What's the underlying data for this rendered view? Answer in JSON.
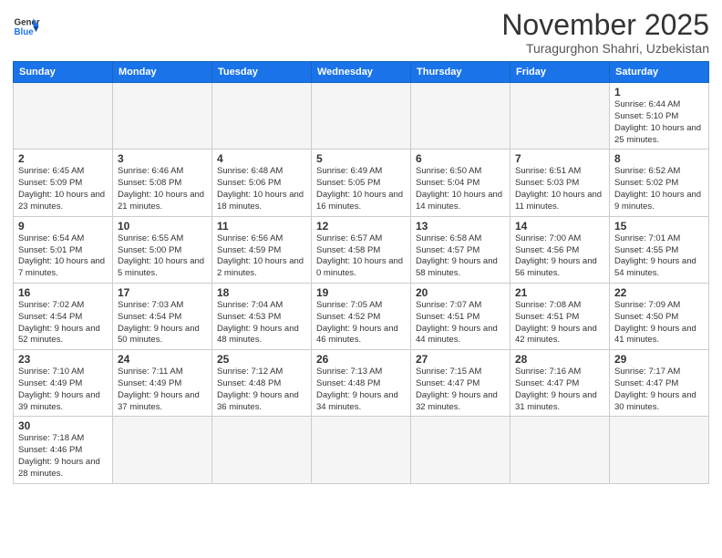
{
  "header": {
    "logo_line1": "General",
    "logo_line2": "Blue",
    "month": "November 2025",
    "location": "Turagurghon Shahri, Uzbekistan"
  },
  "days_of_week": [
    "Sunday",
    "Monday",
    "Tuesday",
    "Wednesday",
    "Thursday",
    "Friday",
    "Saturday"
  ],
  "weeks": [
    [
      {
        "day": "",
        "info": ""
      },
      {
        "day": "",
        "info": ""
      },
      {
        "day": "",
        "info": ""
      },
      {
        "day": "",
        "info": ""
      },
      {
        "day": "",
        "info": ""
      },
      {
        "day": "",
        "info": ""
      },
      {
        "day": "1",
        "info": "Sunrise: 6:44 AM\nSunset: 5:10 PM\nDaylight: 10 hours and 25 minutes."
      }
    ],
    [
      {
        "day": "2",
        "info": "Sunrise: 6:45 AM\nSunset: 5:09 PM\nDaylight: 10 hours and 23 minutes."
      },
      {
        "day": "3",
        "info": "Sunrise: 6:46 AM\nSunset: 5:08 PM\nDaylight: 10 hours and 21 minutes."
      },
      {
        "day": "4",
        "info": "Sunrise: 6:48 AM\nSunset: 5:06 PM\nDaylight: 10 hours and 18 minutes."
      },
      {
        "day": "5",
        "info": "Sunrise: 6:49 AM\nSunset: 5:05 PM\nDaylight: 10 hours and 16 minutes."
      },
      {
        "day": "6",
        "info": "Sunrise: 6:50 AM\nSunset: 5:04 PM\nDaylight: 10 hours and 14 minutes."
      },
      {
        "day": "7",
        "info": "Sunrise: 6:51 AM\nSunset: 5:03 PM\nDaylight: 10 hours and 11 minutes."
      },
      {
        "day": "8",
        "info": "Sunrise: 6:52 AM\nSunset: 5:02 PM\nDaylight: 10 hours and 9 minutes."
      }
    ],
    [
      {
        "day": "9",
        "info": "Sunrise: 6:54 AM\nSunset: 5:01 PM\nDaylight: 10 hours and 7 minutes."
      },
      {
        "day": "10",
        "info": "Sunrise: 6:55 AM\nSunset: 5:00 PM\nDaylight: 10 hours and 5 minutes."
      },
      {
        "day": "11",
        "info": "Sunrise: 6:56 AM\nSunset: 4:59 PM\nDaylight: 10 hours and 2 minutes."
      },
      {
        "day": "12",
        "info": "Sunrise: 6:57 AM\nSunset: 4:58 PM\nDaylight: 10 hours and 0 minutes."
      },
      {
        "day": "13",
        "info": "Sunrise: 6:58 AM\nSunset: 4:57 PM\nDaylight: 9 hours and 58 minutes."
      },
      {
        "day": "14",
        "info": "Sunrise: 7:00 AM\nSunset: 4:56 PM\nDaylight: 9 hours and 56 minutes."
      },
      {
        "day": "15",
        "info": "Sunrise: 7:01 AM\nSunset: 4:55 PM\nDaylight: 9 hours and 54 minutes."
      }
    ],
    [
      {
        "day": "16",
        "info": "Sunrise: 7:02 AM\nSunset: 4:54 PM\nDaylight: 9 hours and 52 minutes."
      },
      {
        "day": "17",
        "info": "Sunrise: 7:03 AM\nSunset: 4:54 PM\nDaylight: 9 hours and 50 minutes."
      },
      {
        "day": "18",
        "info": "Sunrise: 7:04 AM\nSunset: 4:53 PM\nDaylight: 9 hours and 48 minutes."
      },
      {
        "day": "19",
        "info": "Sunrise: 7:05 AM\nSunset: 4:52 PM\nDaylight: 9 hours and 46 minutes."
      },
      {
        "day": "20",
        "info": "Sunrise: 7:07 AM\nSunset: 4:51 PM\nDaylight: 9 hours and 44 minutes."
      },
      {
        "day": "21",
        "info": "Sunrise: 7:08 AM\nSunset: 4:51 PM\nDaylight: 9 hours and 42 minutes."
      },
      {
        "day": "22",
        "info": "Sunrise: 7:09 AM\nSunset: 4:50 PM\nDaylight: 9 hours and 41 minutes."
      }
    ],
    [
      {
        "day": "23",
        "info": "Sunrise: 7:10 AM\nSunset: 4:49 PM\nDaylight: 9 hours and 39 minutes."
      },
      {
        "day": "24",
        "info": "Sunrise: 7:11 AM\nSunset: 4:49 PM\nDaylight: 9 hours and 37 minutes."
      },
      {
        "day": "25",
        "info": "Sunrise: 7:12 AM\nSunset: 4:48 PM\nDaylight: 9 hours and 36 minutes."
      },
      {
        "day": "26",
        "info": "Sunrise: 7:13 AM\nSunset: 4:48 PM\nDaylight: 9 hours and 34 minutes."
      },
      {
        "day": "27",
        "info": "Sunrise: 7:15 AM\nSunset: 4:47 PM\nDaylight: 9 hours and 32 minutes."
      },
      {
        "day": "28",
        "info": "Sunrise: 7:16 AM\nSunset: 4:47 PM\nDaylight: 9 hours and 31 minutes."
      },
      {
        "day": "29",
        "info": "Sunrise: 7:17 AM\nSunset: 4:47 PM\nDaylight: 9 hours and 30 minutes."
      }
    ],
    [
      {
        "day": "30",
        "info": "Sunrise: 7:18 AM\nSunset: 4:46 PM\nDaylight: 9 hours and 28 minutes."
      },
      {
        "day": "",
        "info": ""
      },
      {
        "day": "",
        "info": ""
      },
      {
        "day": "",
        "info": ""
      },
      {
        "day": "",
        "info": ""
      },
      {
        "day": "",
        "info": ""
      },
      {
        "day": "",
        "info": ""
      }
    ]
  ]
}
